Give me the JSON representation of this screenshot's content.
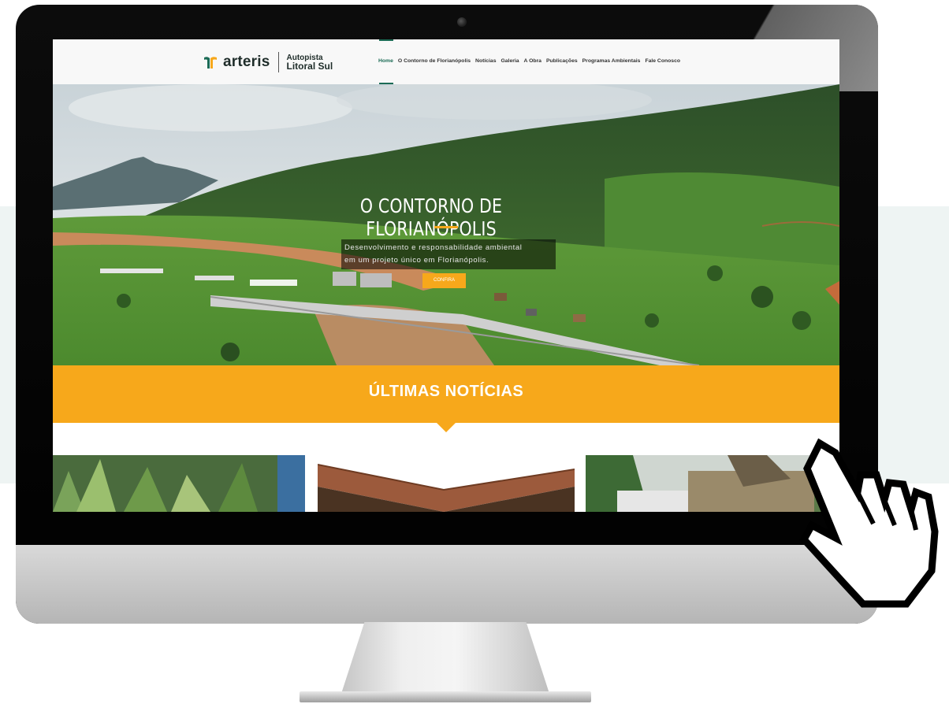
{
  "site": {
    "brand": "arteris",
    "brand_sub_1": "Autopista",
    "brand_sub_2": "Litoral Sul",
    "accent_color": "#1b6b55",
    "highlight_color": "#f7a81b"
  },
  "nav": {
    "items": [
      {
        "label": "Home",
        "active": true
      },
      {
        "label": "O Contorno de Florianópolis",
        "active": false
      },
      {
        "label": "Notícias",
        "active": false
      },
      {
        "label": "Galeria",
        "active": false
      },
      {
        "label": "A Obra",
        "active": false
      },
      {
        "label": "Publicações",
        "active": false
      },
      {
        "label": "Programas Ambientais",
        "active": false
      },
      {
        "label": "Fale Conosco",
        "active": false
      }
    ]
  },
  "hero": {
    "title": "O CONTORNO DE FLORIANÓPOLIS",
    "description_line1": "Desenvolvimento e responsabilidade ambiental",
    "description_line2": "em um projeto único em Florianópolis.",
    "button_label": "CONFIRA"
  },
  "news": {
    "section_title": "ÚLTIMAS NOTÍCIAS"
  },
  "icons": [
    "arteris-logo-icon",
    "hand-pointer-icon"
  ]
}
